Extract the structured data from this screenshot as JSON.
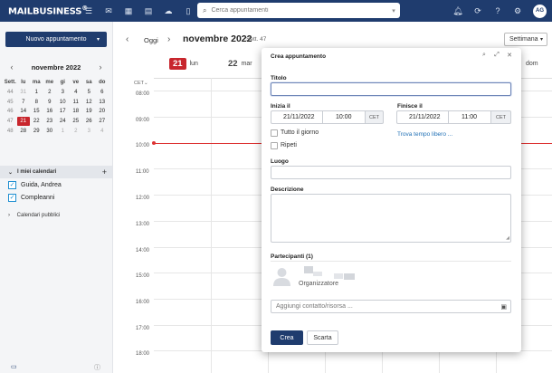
{
  "topbar": {
    "logo": "MAILBUSINESS",
    "logo_mark": "®",
    "search_placeholder": "Cerca appuntamenti",
    "avatar_initials": "AG"
  },
  "sidebar": {
    "new_button": "Nuovo appuntamento",
    "mini_calendar": {
      "title": "novembre 2022",
      "headers": [
        "Sett.",
        "lu",
        "ma",
        "me",
        "gi",
        "ve",
        "sa",
        "do"
      ],
      "weeks": [
        {
          "wk": "44",
          "days": [
            "31",
            "1",
            "2",
            "3",
            "4",
            "5",
            "6"
          ]
        },
        {
          "wk": "45",
          "days": [
            "7",
            "8",
            "9",
            "10",
            "11",
            "12",
            "13"
          ]
        },
        {
          "wk": "46",
          "days": [
            "14",
            "15",
            "16",
            "17",
            "18",
            "19",
            "20"
          ]
        },
        {
          "wk": "47",
          "days": [
            "21",
            "22",
            "23",
            "24",
            "25",
            "26",
            "27"
          ]
        },
        {
          "wk": "48",
          "days": [
            "28",
            "29",
            "30",
            "1",
            "2",
            "3",
            "4"
          ]
        }
      ]
    },
    "my_calendars_label": "I miei calendari",
    "calendars": [
      {
        "name": "Guida, Andrea",
        "checked": true
      },
      {
        "name": "Compleanni",
        "checked": true
      }
    ],
    "public_calendars_label": "Calendari pubblici"
  },
  "calendar": {
    "today_label": "Oggi",
    "title": "novembre 2022",
    "week_label": "Sett. 47",
    "view": "Settimana",
    "days": [
      {
        "num": "21",
        "name": "lun",
        "today": true
      },
      {
        "num": "22",
        "name": "mar",
        "today": false
      },
      {
        "num": "",
        "name": "dom",
        "today": false
      }
    ],
    "timezone_label": "CET",
    "hours": [
      "08:00",
      "09:00",
      "10:00",
      "11:00",
      "12:00",
      "13:00",
      "14:00",
      "15:00",
      "16:00",
      "17:00",
      "18:00"
    ],
    "now_color": "#d33333"
  },
  "dialog": {
    "title": "Crea appuntamento",
    "titolo_label": "Titolo",
    "titolo_value": "",
    "start_label": "Inizia il",
    "start_date": "21/11/2022",
    "start_time": "10:00",
    "end_label": "Finisce il",
    "end_date": "21/11/2022",
    "end_time": "11:00",
    "tz": "CET",
    "all_day_label": "Tutto il giorno",
    "repeat_label": "Ripeti",
    "free_time_link": "Trova tempo libero ...",
    "place_label": "Luogo",
    "description_label": "Descrizione",
    "participants_label": "Partecipanti (1)",
    "organizer_label": "Organizzatore",
    "add_contact_placeholder": "Aggiungi contatto/risorsa ...",
    "create_button": "Crea",
    "cancel_button": "Scarta"
  },
  "colors": {
    "brand": "#1f3c6e",
    "today": "#c8262d",
    "link": "#1f6fb5"
  }
}
